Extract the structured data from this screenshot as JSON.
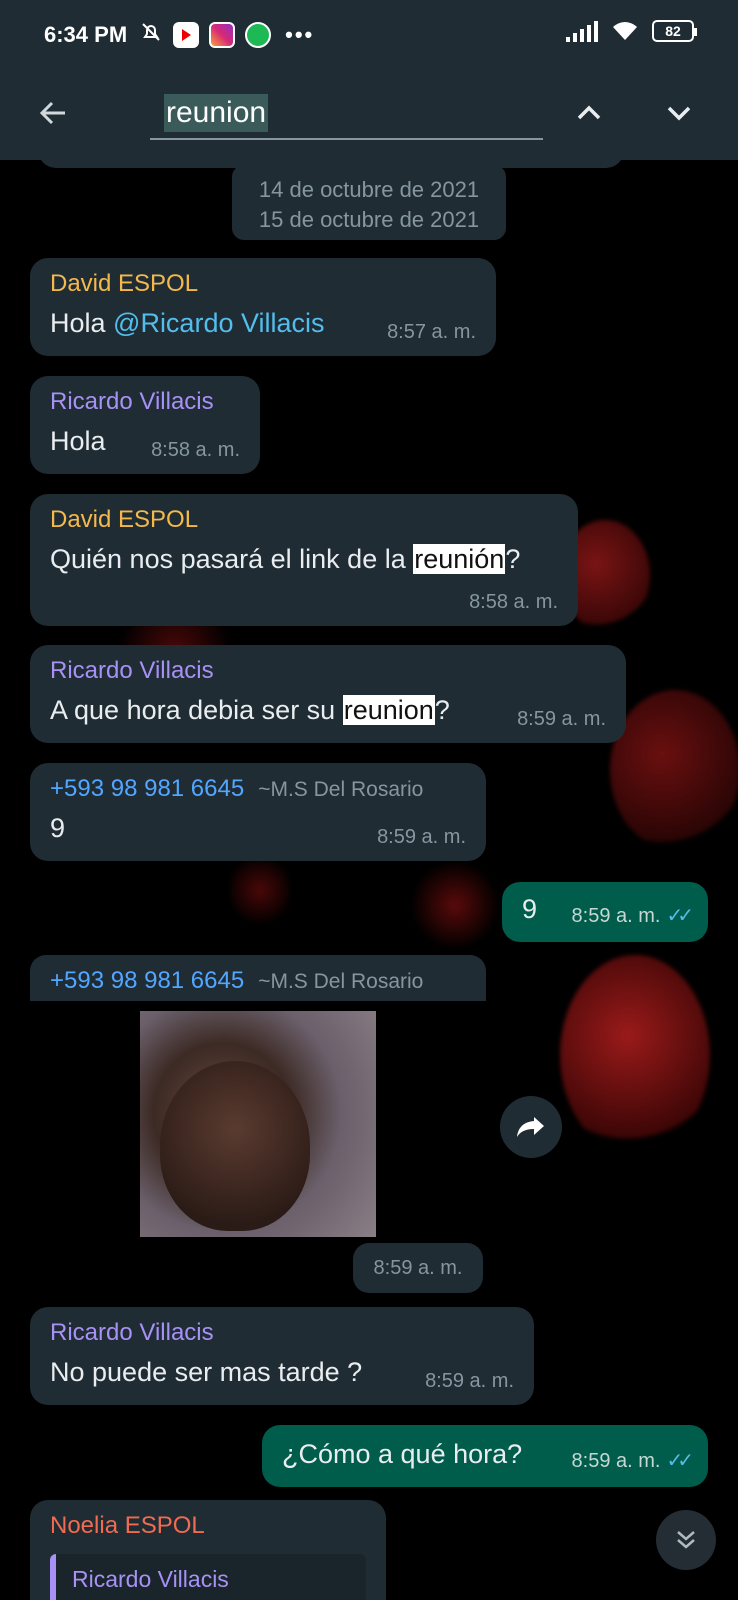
{
  "status_bar": {
    "time": "6:34 PM",
    "battery": "82",
    "icons": [
      "mute-bell-icon",
      "youtube-icon",
      "instagram-icon",
      "spotify-icon",
      "more-icon",
      "signal-icon",
      "wifi-icon",
      "battery-icon"
    ]
  },
  "search": {
    "query": "reunion",
    "back_icon": "arrow-left-icon",
    "up_icon": "chevron-up-icon",
    "down_icon": "chevron-down-icon"
  },
  "date_chip": {
    "label": "14 de octubre de 2021",
    "ghost_label": "15 de octubre de 2021"
  },
  "messages": [
    {
      "sender": "David ESPOL",
      "text_prefix": "Hola ",
      "mention": "@Ricardo Villacis",
      "time": "8:57 a. m."
    },
    {
      "sender": "Ricardo Villacis",
      "text": "Hola",
      "time": "8:58 a. m."
    },
    {
      "sender": "David ESPOL",
      "text_prefix": "Quién nos pasará el link de la ",
      "highlight": "reunión",
      "text_suffix": "?",
      "time": "8:58 a. m."
    },
    {
      "sender": "Ricardo Villacis",
      "text_prefix": "A que hora debia ser su ",
      "highlight": "reunion",
      "text_suffix": "?",
      "time": "8:59 a. m."
    },
    {
      "sender": "+593 98 981 6645",
      "sub_name": "~M.S Del Rosario",
      "text": "9",
      "time": "8:59 a. m."
    },
    {
      "outgoing": true,
      "text": "9",
      "time": "8:59 a. m.",
      "ticks": "✓✓"
    },
    {
      "sender": "+593 98 981 6645",
      "sub_name": "~M.S Del Rosario",
      "media": "sticker-image",
      "time": "8:59 a. m."
    },
    {
      "sender": "Ricardo Villacis",
      "text": "No puede ser mas tarde ?",
      "time": "8:59 a. m."
    },
    {
      "outgoing": true,
      "text": "¿Cómo a qué hora?",
      "time": "8:59 a. m.",
      "ticks": "✓✓"
    },
    {
      "sender": "Noelia ESPOL",
      "quote_sender": "Ricardo Villacis"
    }
  ],
  "colors": {
    "bubble_in": "#1f2c34",
    "bubble_out": "#005c4b",
    "sender_orange": "#f5b94b",
    "sender_purple": "#a791f5",
    "sender_blue": "#53a6ff",
    "sender_red": "#f26a4f",
    "highlight": "#ffffff"
  }
}
